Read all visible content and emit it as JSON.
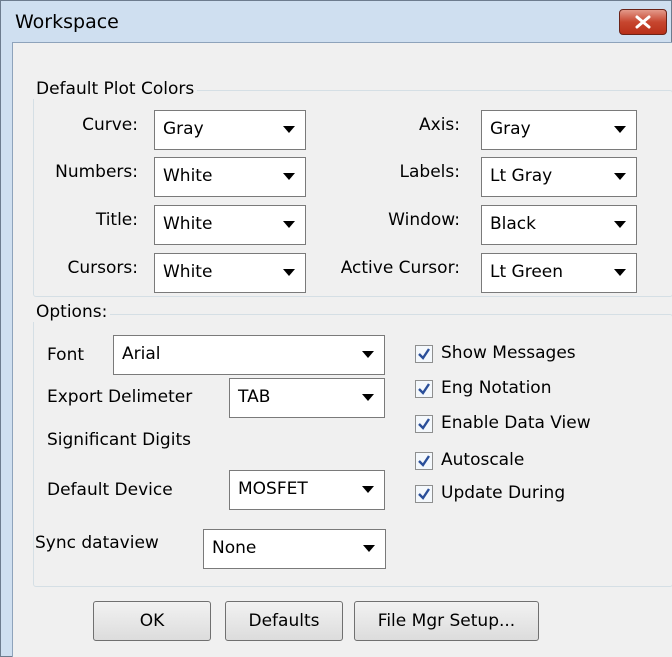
{
  "window": {
    "title": "Workspace"
  },
  "plot_colors": {
    "legend": "Default Plot Colors",
    "curve": {
      "label": "Curve:",
      "value": "Gray"
    },
    "axis": {
      "label": "Axis:",
      "value": "Gray"
    },
    "numbers": {
      "label": "Numbers:",
      "value": "White"
    },
    "labels": {
      "label": "Labels:",
      "value": "Lt Gray"
    },
    "title": {
      "label": "Title:",
      "value": "White"
    },
    "window": {
      "label": "Window:",
      "value": "Black"
    },
    "cursors": {
      "label": "Cursors:",
      "value": "White"
    },
    "active_cursor": {
      "label": "Active Cursor:",
      "value": "Lt Green"
    }
  },
  "options": {
    "legend": "Options:",
    "font": {
      "label": "Font",
      "value": "Arial"
    },
    "export_delimeter": {
      "label": "Export Delimeter",
      "value": "TAB"
    },
    "significant_digits": {
      "label": "Significant Digits"
    },
    "default_device": {
      "label": "Default Device",
      "value": "MOSFET"
    },
    "checkboxes": [
      {
        "label": "Show Messages",
        "checked": true
      },
      {
        "label": "Eng Notation",
        "checked": true
      },
      {
        "label": "Enable Data View",
        "checked": true
      },
      {
        "label": "Autoscale",
        "checked": true
      },
      {
        "label": "Update  During",
        "checked": true
      }
    ]
  },
  "sync_dataview": {
    "label": "Sync dataview",
    "value": "None"
  },
  "buttons": {
    "ok": "OK",
    "defaults": "Defaults",
    "file_mgr": "File Mgr Setup..."
  }
}
